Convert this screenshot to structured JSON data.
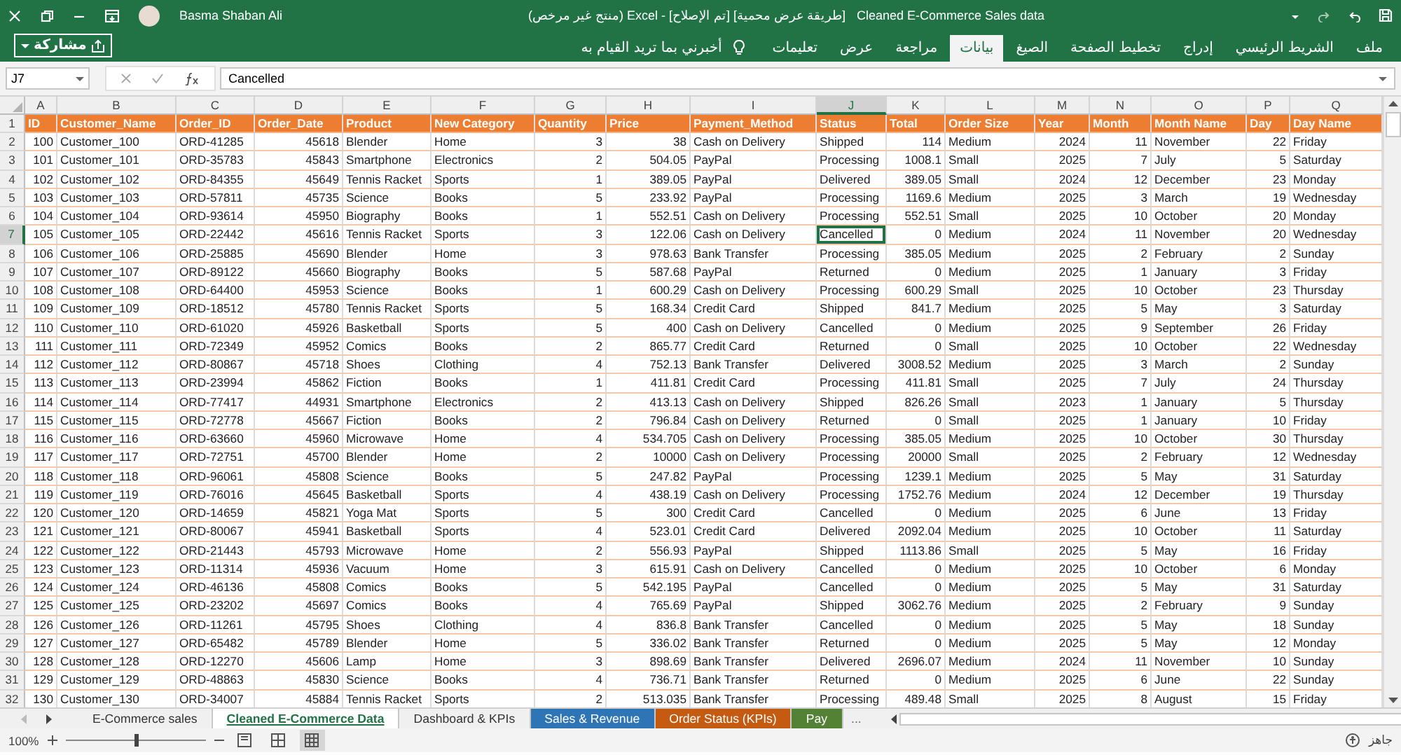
{
  "title_bar": {
    "user_name": "Basma Shaban Ali",
    "document_title": "Cleaned E-Commerce Sales data",
    "status_text": "[طريقة عرض محمية] [تم الإصلاح] - Excel (منتج غير مرخص)"
  },
  "ribbon": {
    "share_button": "مشاركة",
    "tell_me": "أخبرني بما تريد القيام به",
    "tabs": [
      {
        "label": "ملف",
        "selected": false
      },
      {
        "label": "الشريط الرئيسي",
        "selected": false
      },
      {
        "label": "إدراج",
        "selected": false
      },
      {
        "label": "تخطيط الصفحة",
        "selected": false
      },
      {
        "label": "الصيغ",
        "selected": false
      },
      {
        "label": "بيانات",
        "selected": true
      },
      {
        "label": "مراجعة",
        "selected": false
      },
      {
        "label": "عرض",
        "selected": false
      },
      {
        "label": "تعليمات",
        "selected": false
      }
    ]
  },
  "formula_bar": {
    "name_box": "J7",
    "value": "Cancelled"
  },
  "sheet": {
    "columns": [
      {
        "letter": "A",
        "selected": false
      },
      {
        "letter": "B",
        "selected": false
      },
      {
        "letter": "C",
        "selected": false
      },
      {
        "letter": "D",
        "selected": false
      },
      {
        "letter": "E",
        "selected": false
      },
      {
        "letter": "F",
        "selected": false
      },
      {
        "letter": "G",
        "selected": false
      },
      {
        "letter": "H",
        "selected": false
      },
      {
        "letter": "I",
        "selected": false
      },
      {
        "letter": "J",
        "selected": true
      },
      {
        "letter": "K",
        "selected": false
      },
      {
        "letter": "L",
        "selected": false
      },
      {
        "letter": "M",
        "selected": false
      },
      {
        "letter": "N",
        "selected": false
      },
      {
        "letter": "O",
        "selected": false
      },
      {
        "letter": "P",
        "selected": false
      },
      {
        "letter": "Q",
        "selected": false
      }
    ],
    "header_row": {
      "num": "1",
      "selected": false,
      "cells": [
        "ID",
        "Customer_Name",
        "Order_ID",
        "Order_Date",
        "Product",
        "New Category",
        "Quantity",
        "Price",
        "Payment_Method",
        "Status",
        "Total",
        "Order Size",
        "Year",
        "Month",
        "Month Name",
        "Day",
        "Day Name"
      ]
    },
    "rows": [
      {
        "num": "2",
        "selected": false,
        "cells": [
          "100",
          "Customer_100",
          "ORD-41285",
          "45618",
          "Blender",
          "Home",
          "3",
          "38",
          "Cash on Delivery",
          "Shipped",
          "114",
          "Medium",
          "2024",
          "11",
          "November",
          "22",
          "Friday"
        ]
      },
      {
        "num": "3",
        "selected": false,
        "cells": [
          "101",
          "Customer_101",
          "ORD-35783",
          "45843",
          "Smartphone",
          "Electronics",
          "2",
          "504.05",
          "PayPal",
          "Processing",
          "1008.1",
          "Small",
          "2025",
          "7",
          "July",
          "5",
          "Saturday"
        ]
      },
      {
        "num": "4",
        "selected": false,
        "cells": [
          "102",
          "Customer_102",
          "ORD-84355",
          "45649",
          "Tennis Racket",
          "Sports",
          "1",
          "389.05",
          "PayPal",
          "Delivered",
          "389.05",
          "Small",
          "2024",
          "12",
          "December",
          "23",
          "Monday"
        ]
      },
      {
        "num": "5",
        "selected": false,
        "cells": [
          "103",
          "Customer_103",
          "ORD-57811",
          "45735",
          "Science",
          "Books",
          "5",
          "233.92",
          "PayPal",
          "Processing",
          "1169.6",
          "Medium",
          "2025",
          "3",
          "March",
          "19",
          "Wednesday"
        ]
      },
      {
        "num": "6",
        "selected": false,
        "cells": [
          "104",
          "Customer_104",
          "ORD-93614",
          "45950",
          "Biography",
          "Books",
          "1",
          "552.51",
          "Cash on Delivery",
          "Processing",
          "552.51",
          "Small",
          "2025",
          "10",
          "October",
          "20",
          "Monday"
        ]
      },
      {
        "num": "7",
        "selected": true,
        "cells": [
          "105",
          "Customer_105",
          "ORD-22442",
          "45616",
          "Tennis Racket",
          "Sports",
          "3",
          "122.06",
          "Cash on Delivery",
          "Cancelled",
          "0",
          "Medium",
          "2024",
          "11",
          "November",
          "20",
          "Wednesday"
        ]
      },
      {
        "num": "8",
        "selected": false,
        "cells": [
          "106",
          "Customer_106",
          "ORD-25885",
          "45690",
          "Blender",
          "Home",
          "3",
          "978.63",
          "Bank Transfer",
          "Processing",
          "385.05",
          "Medium",
          "2025",
          "2",
          "February",
          "2",
          "Sunday"
        ]
      },
      {
        "num": "9",
        "selected": false,
        "cells": [
          "107",
          "Customer_107",
          "ORD-89122",
          "45660",
          "Biography",
          "Books",
          "5",
          "587.68",
          "PayPal",
          "Returned",
          "0",
          "Medium",
          "2025",
          "1",
          "January",
          "3",
          "Friday"
        ]
      },
      {
        "num": "10",
        "selected": false,
        "cells": [
          "108",
          "Customer_108",
          "ORD-64400",
          "45953",
          "Science",
          "Books",
          "1",
          "600.29",
          "Cash on Delivery",
          "Processing",
          "600.29",
          "Small",
          "2025",
          "10",
          "October",
          "23",
          "Thursday"
        ]
      },
      {
        "num": "11",
        "selected": false,
        "cells": [
          "109",
          "Customer_109",
          "ORD-18512",
          "45780",
          "Tennis Racket",
          "Sports",
          "5",
          "168.34",
          "Credit Card",
          "Shipped",
          "841.7",
          "Medium",
          "2025",
          "5",
          "May",
          "3",
          "Saturday"
        ]
      },
      {
        "num": "12",
        "selected": false,
        "cells": [
          "110",
          "Customer_110",
          "ORD-61020",
          "45926",
          "Basketball",
          "Sports",
          "5",
          "400",
          "Cash on Delivery",
          "Cancelled",
          "0",
          "Medium",
          "2025",
          "9",
          "September",
          "26",
          "Friday"
        ]
      },
      {
        "num": "13",
        "selected": false,
        "cells": [
          "111",
          "Customer_111",
          "ORD-72349",
          "45952",
          "Comics",
          "Books",
          "2",
          "865.77",
          "Credit Card",
          "Returned",
          "0",
          "Small",
          "2025",
          "10",
          "October",
          "22",
          "Wednesday"
        ]
      },
      {
        "num": "14",
        "selected": false,
        "cells": [
          "112",
          "Customer_112",
          "ORD-80867",
          "45718",
          "Shoes",
          "Clothing",
          "4",
          "752.13",
          "Bank Transfer",
          "Delivered",
          "3008.52",
          "Medium",
          "2025",
          "3",
          "March",
          "2",
          "Sunday"
        ]
      },
      {
        "num": "15",
        "selected": false,
        "cells": [
          "113",
          "Customer_113",
          "ORD-23994",
          "45862",
          "Fiction",
          "Books",
          "1",
          "411.81",
          "Credit Card",
          "Processing",
          "411.81",
          "Small",
          "2025",
          "7",
          "July",
          "24",
          "Thursday"
        ]
      },
      {
        "num": "16",
        "selected": false,
        "cells": [
          "114",
          "Customer_114",
          "ORD-77417",
          "44931",
          "Smartphone",
          "Electronics",
          "2",
          "413.13",
          "Cash on Delivery",
          "Shipped",
          "826.26",
          "Small",
          "2023",
          "1",
          "January",
          "5",
          "Thursday"
        ]
      },
      {
        "num": "17",
        "selected": false,
        "cells": [
          "115",
          "Customer_115",
          "ORD-72778",
          "45667",
          "Fiction",
          "Books",
          "2",
          "796.84",
          "Cash on Delivery",
          "Returned",
          "0",
          "Small",
          "2025",
          "1",
          "January",
          "10",
          "Friday"
        ]
      },
      {
        "num": "18",
        "selected": false,
        "cells": [
          "116",
          "Customer_116",
          "ORD-63660",
          "45960",
          "Microwave",
          "Home",
          "4",
          "534.705",
          "Cash on Delivery",
          "Processing",
          "385.05",
          "Medium",
          "2025",
          "10",
          "October",
          "30",
          "Thursday"
        ]
      },
      {
        "num": "19",
        "selected": false,
        "cells": [
          "117",
          "Customer_117",
          "ORD-72751",
          "45700",
          "Blender",
          "Home",
          "2",
          "10000",
          "Cash on Delivery",
          "Processing",
          "20000",
          "Small",
          "2025",
          "2",
          "February",
          "12",
          "Wednesday"
        ]
      },
      {
        "num": "20",
        "selected": false,
        "cells": [
          "118",
          "Customer_118",
          "ORD-96061",
          "45808",
          "Science",
          "Books",
          "5",
          "247.82",
          "PayPal",
          "Processing",
          "1239.1",
          "Medium",
          "2025",
          "5",
          "May",
          "31",
          "Saturday"
        ]
      },
      {
        "num": "21",
        "selected": false,
        "cells": [
          "119",
          "Customer_119",
          "ORD-76016",
          "45645",
          "Basketball",
          "Sports",
          "4",
          "438.19",
          "Cash on Delivery",
          "Processing",
          "1752.76",
          "Medium",
          "2024",
          "12",
          "December",
          "19",
          "Thursday"
        ]
      },
      {
        "num": "22",
        "selected": false,
        "cells": [
          "120",
          "Customer_120",
          "ORD-14659",
          "45821",
          "Yoga Mat",
          "Sports",
          "5",
          "300",
          "Credit Card",
          "Cancelled",
          "0",
          "Medium",
          "2025",
          "6",
          "June",
          "13",
          "Friday"
        ]
      },
      {
        "num": "23",
        "selected": false,
        "cells": [
          "121",
          "Customer_121",
          "ORD-80067",
          "45941",
          "Basketball",
          "Sports",
          "4",
          "523.01",
          "Credit Card",
          "Delivered",
          "2092.04",
          "Medium",
          "2025",
          "10",
          "October",
          "11",
          "Saturday"
        ]
      },
      {
        "num": "24",
        "selected": false,
        "cells": [
          "122",
          "Customer_122",
          "ORD-21443",
          "45793",
          "Microwave",
          "Home",
          "2",
          "556.93",
          "PayPal",
          "Shipped",
          "1113.86",
          "Small",
          "2025",
          "5",
          "May",
          "16",
          "Friday"
        ]
      },
      {
        "num": "25",
        "selected": false,
        "cells": [
          "123",
          "Customer_123",
          "ORD-11314",
          "45936",
          "Vacuum",
          "Home",
          "3",
          "615.91",
          "Cash on Delivery",
          "Cancelled",
          "0",
          "Medium",
          "2025",
          "10",
          "October",
          "6",
          "Monday"
        ]
      },
      {
        "num": "26",
        "selected": false,
        "cells": [
          "124",
          "Customer_124",
          "ORD-46136",
          "45808",
          "Comics",
          "Books",
          "5",
          "542.195",
          "PayPal",
          "Cancelled",
          "0",
          "Medium",
          "2025",
          "5",
          "May",
          "31",
          "Saturday"
        ]
      },
      {
        "num": "27",
        "selected": false,
        "cells": [
          "125",
          "Customer_125",
          "ORD-23202",
          "45697",
          "Comics",
          "Books",
          "4",
          "765.69",
          "PayPal",
          "Shipped",
          "3062.76",
          "Medium",
          "2025",
          "2",
          "February",
          "9",
          "Sunday"
        ]
      },
      {
        "num": "28",
        "selected": false,
        "cells": [
          "126",
          "Customer_126",
          "ORD-11261",
          "45795",
          "Shoes",
          "Clothing",
          "4",
          "836.8",
          "Bank Transfer",
          "Cancelled",
          "0",
          "Medium",
          "2025",
          "5",
          "May",
          "18",
          "Sunday"
        ]
      },
      {
        "num": "29",
        "selected": false,
        "cells": [
          "127",
          "Customer_127",
          "ORD-65482",
          "45789",
          "Blender",
          "Home",
          "5",
          "336.02",
          "Bank Transfer",
          "Returned",
          "0",
          "Medium",
          "2025",
          "5",
          "May",
          "12",
          "Monday"
        ]
      },
      {
        "num": "30",
        "selected": false,
        "cells": [
          "128",
          "Customer_128",
          "ORD-12270",
          "45606",
          "Lamp",
          "Home",
          "3",
          "898.69",
          "Bank Transfer",
          "Delivered",
          "2696.07",
          "Medium",
          "2024",
          "11",
          "November",
          "10",
          "Sunday"
        ]
      },
      {
        "num": "31",
        "selected": false,
        "cells": [
          "129",
          "Customer_129",
          "ORD-48863",
          "45830",
          "Science",
          "Books",
          "4",
          "736.71",
          "Bank Transfer",
          "Returned",
          "0",
          "Medium",
          "2025",
          "6",
          "June",
          "22",
          "Sunday"
        ]
      },
      {
        "num": "32",
        "selected": false,
        "cells": [
          "130",
          "Customer_130",
          "ORD-34007",
          "45884",
          "Tennis Racket",
          "Sports",
          "2",
          "513.035",
          "Bank Transfer",
          "Processing",
          "489.48",
          "Small",
          "2025",
          "8",
          "August",
          "15",
          "Friday"
        ]
      }
    ]
  },
  "sheet_tabs": {
    "more": "...",
    "tabs": [
      {
        "label": "E-Commerce sales",
        "selected": false
      },
      {
        "label": "Cleaned E-Commerce Data",
        "selected": true
      },
      {
        "label": "Dashboard & KPIs",
        "selected": false
      },
      {
        "label": "Sales & Revenue",
        "selected": false,
        "color": "#2e75b6"
      },
      {
        "label": "Order Status (KPIs)",
        "selected": false,
        "color": "#c55a11"
      },
      {
        "label": "Pay",
        "selected": false,
        "color": "#548235"
      }
    ]
  },
  "status_bar": {
    "zoom": "100%",
    "zoom_slider": {
      "level": 0.5
    },
    "ready": "جاهز",
    "views": [
      {
        "kind": "page-layout",
        "selected": false
      },
      {
        "kind": "page-break",
        "selected": false
      },
      {
        "kind": "normal",
        "selected": true
      }
    ]
  }
}
